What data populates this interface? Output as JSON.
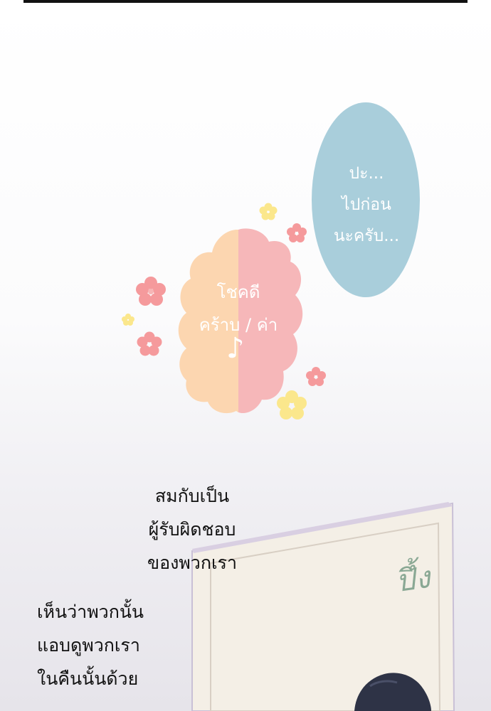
{
  "bubbles": {
    "blue": {
      "lines": [
        "ปะ...",
        "ไปก่อน",
        "นะครับ..."
      ],
      "color": "#a9cedb"
    },
    "cloud": {
      "lines": [
        "โชคดี",
        "คร้าบ / ค่า"
      ],
      "note": "♪",
      "left_color": "#fcd6b0",
      "right_color": "#f6b7b9"
    }
  },
  "captions": {
    "first": [
      "สมกับเป็น",
      "ผู้รับผิดชอบ",
      "ของพวกเรา"
    ],
    "second": [
      "เห็นว่าพวกนั้น",
      "แอบดูพวกเรา",
      "ในคืนนั้นด้วย"
    ]
  },
  "sfx": "ปึ้ง",
  "icons": {
    "flower_pink": "#f59a9c",
    "flower_yellow": "#fbe78c"
  }
}
